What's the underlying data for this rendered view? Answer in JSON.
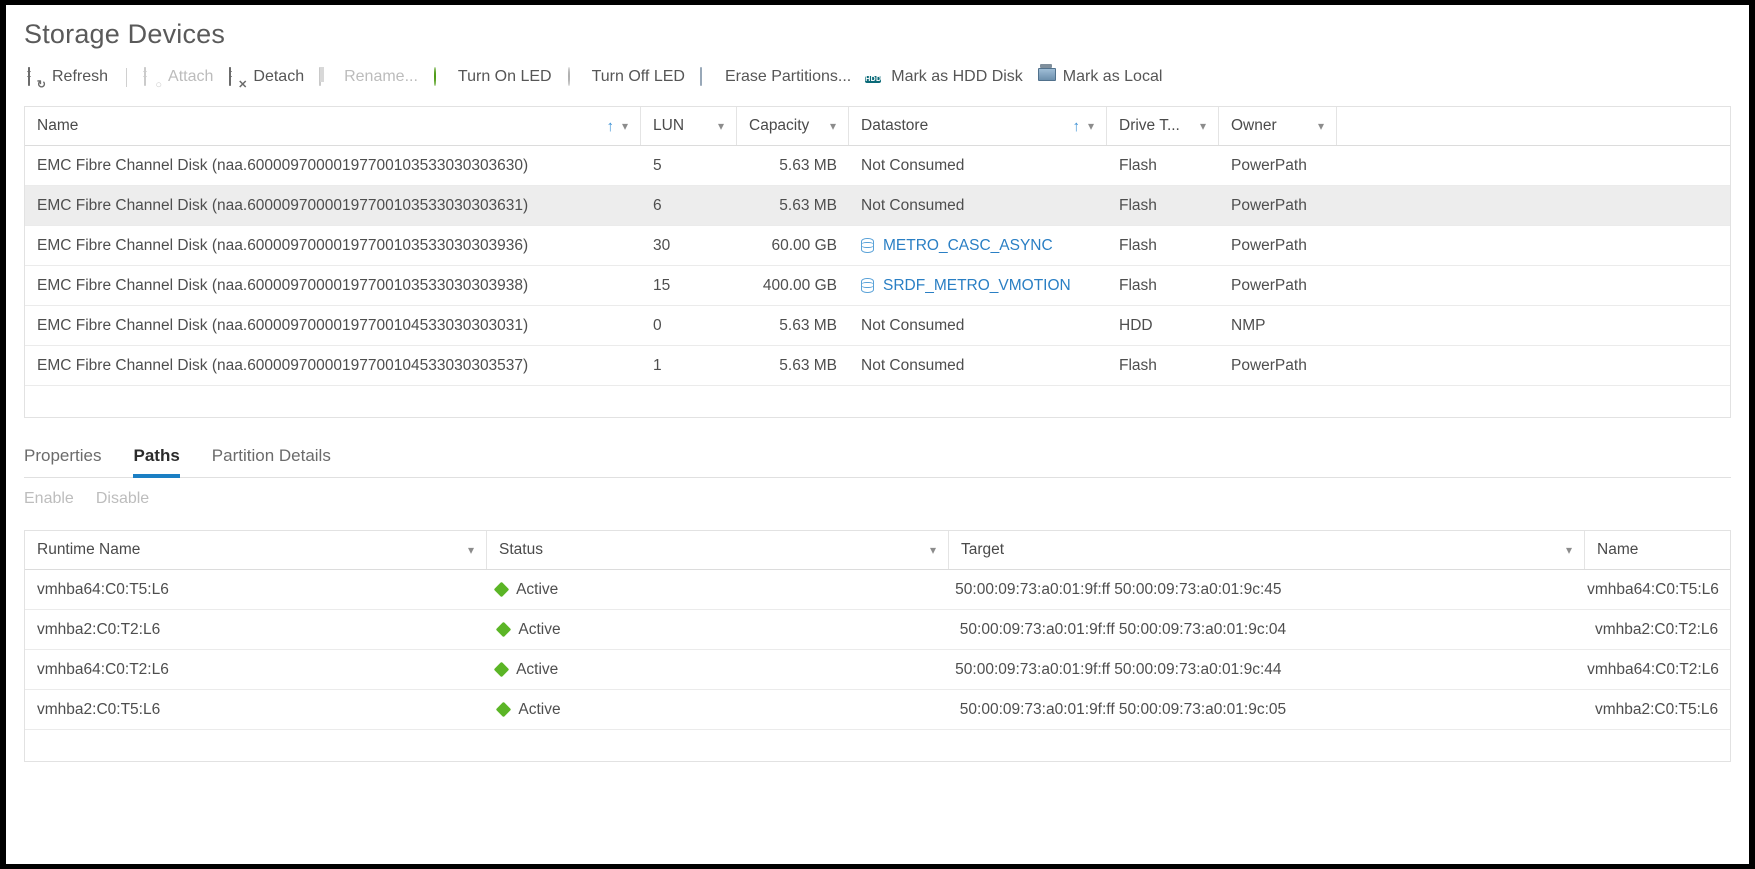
{
  "page": {
    "title": "Storage Devices"
  },
  "toolbar": {
    "items": [
      {
        "label": "Refresh",
        "icon": "refresh-disk-icon",
        "disabled": false,
        "badge": "↻"
      },
      {
        "label": "Attach",
        "icon": "attach-disk-icon",
        "disabled": true,
        "badge": "○"
      },
      {
        "label": "Detach",
        "icon": "detach-disk-icon",
        "disabled": false,
        "badge": "✕"
      },
      {
        "label": "Rename...",
        "icon": "rename-icon",
        "disabled": true,
        "badge": ""
      },
      {
        "label": "Turn On LED",
        "icon": "led-on-icon",
        "disabled": false,
        "badge": ""
      },
      {
        "label": "Turn Off LED",
        "icon": "led-off-icon",
        "disabled": false,
        "badge": ""
      },
      {
        "label": "Erase Partitions...",
        "icon": "erase-partitions-icon",
        "disabled": false,
        "badge": ""
      },
      {
        "label": "Mark as HDD Disk",
        "icon": "hdd-icon",
        "disabled": false,
        "badge": "HDD"
      },
      {
        "label": "Mark as Local",
        "icon": "local-monitor-icon",
        "disabled": false,
        "badge": ""
      }
    ]
  },
  "devices_table": {
    "columns": [
      {
        "key": "name",
        "label": "Name",
        "sort": "asc",
        "caret": true
      },
      {
        "key": "lun",
        "label": "LUN",
        "sort": "",
        "caret": true
      },
      {
        "key": "capacity",
        "label": "Capacity",
        "sort": "",
        "caret": true
      },
      {
        "key": "datastore",
        "label": "Datastore",
        "sort": "asc",
        "caret": true
      },
      {
        "key": "drive",
        "label": "Drive T...",
        "sort": "",
        "caret": true
      },
      {
        "key": "owner",
        "label": "Owner",
        "sort": "",
        "caret": true
      }
    ],
    "rows": [
      {
        "name": "EMC Fibre Channel Disk (naa.60000970000197700103533030303630)",
        "lun": "5",
        "capacity": "5.63 MB",
        "datastore": "Not Consumed",
        "datastore_link": false,
        "drive": "Flash",
        "owner": "PowerPath",
        "selected": false
      },
      {
        "name": "EMC Fibre Channel Disk (naa.60000970000197700103533030303631)",
        "lun": "6",
        "capacity": "5.63 MB",
        "datastore": "Not Consumed",
        "datastore_link": false,
        "drive": "Flash",
        "owner": "PowerPath",
        "selected": true
      },
      {
        "name": "EMC Fibre Channel Disk (naa.60000970000197700103533030303936)",
        "lun": "30",
        "capacity": "60.00 GB",
        "datastore": "METRO_CASC_ASYNC",
        "datastore_link": true,
        "drive": "Flash",
        "owner": "PowerPath",
        "selected": false
      },
      {
        "name": "EMC Fibre Channel Disk (naa.60000970000197700103533030303938)",
        "lun": "15",
        "capacity": "400.00 GB",
        "datastore": "SRDF_METRO_VMOTION",
        "datastore_link": true,
        "drive": "Flash",
        "owner": "PowerPath",
        "selected": false
      },
      {
        "name": "EMC Fibre Channel Disk (naa.60000970000197700104533030303031)",
        "lun": "0",
        "capacity": "5.63 MB",
        "datastore": "Not Consumed",
        "datastore_link": false,
        "drive": "HDD",
        "owner": "NMP",
        "selected": false
      },
      {
        "name": "EMC Fibre Channel Disk (naa.60000970000197700104533030303537)",
        "lun": "1",
        "capacity": "5.63 MB",
        "datastore": "Not Consumed",
        "datastore_link": false,
        "drive": "Flash",
        "owner": "PowerPath",
        "selected": false
      }
    ]
  },
  "detail": {
    "tabs": [
      {
        "label": "Properties",
        "active": false
      },
      {
        "label": "Paths",
        "active": true
      },
      {
        "label": "Partition Details",
        "active": false
      }
    ],
    "actions": [
      {
        "label": "Enable",
        "disabled": true
      },
      {
        "label": "Disable",
        "disabled": true
      }
    ],
    "paths_table": {
      "columns": [
        {
          "key": "runtime",
          "label": "Runtime Name",
          "caret": true
        },
        {
          "key": "status",
          "label": "Status",
          "caret": true
        },
        {
          "key": "target",
          "label": "Target",
          "caret": true
        },
        {
          "key": "name",
          "label": "Name",
          "caret": false
        }
      ],
      "rows": [
        {
          "runtime": "vmhba64:C0:T5:L6",
          "status": "Active",
          "target": "50:00:09:73:a0:01:9f:ff 50:00:09:73:a0:01:9c:45",
          "name": "vmhba64:C0:T5:L6"
        },
        {
          "runtime": "vmhba2:C0:T2:L6",
          "status": "Active",
          "target": "50:00:09:73:a0:01:9f:ff 50:00:09:73:a0:01:9c:04",
          "name": "vmhba2:C0:T2:L6"
        },
        {
          "runtime": "vmhba64:C0:T2:L6",
          "status": "Active",
          "target": "50:00:09:73:a0:01:9f:ff 50:00:09:73:a0:01:9c:44",
          "name": "vmhba64:C0:T2:L6"
        },
        {
          "runtime": "vmhba2:C0:T5:L6",
          "status": "Active",
          "target": "50:00:09:73:a0:01:9f:ff 50:00:09:73:a0:01:9c:05",
          "name": "vmhba2:C0:T5:L6"
        }
      ]
    }
  },
  "colors": {
    "accent": "#1b7fc4",
    "link": "#2a7fc4",
    "status_active": "#5bb526",
    "sort_arrow": "#3a8fd4",
    "selected_row": "#ededed"
  }
}
